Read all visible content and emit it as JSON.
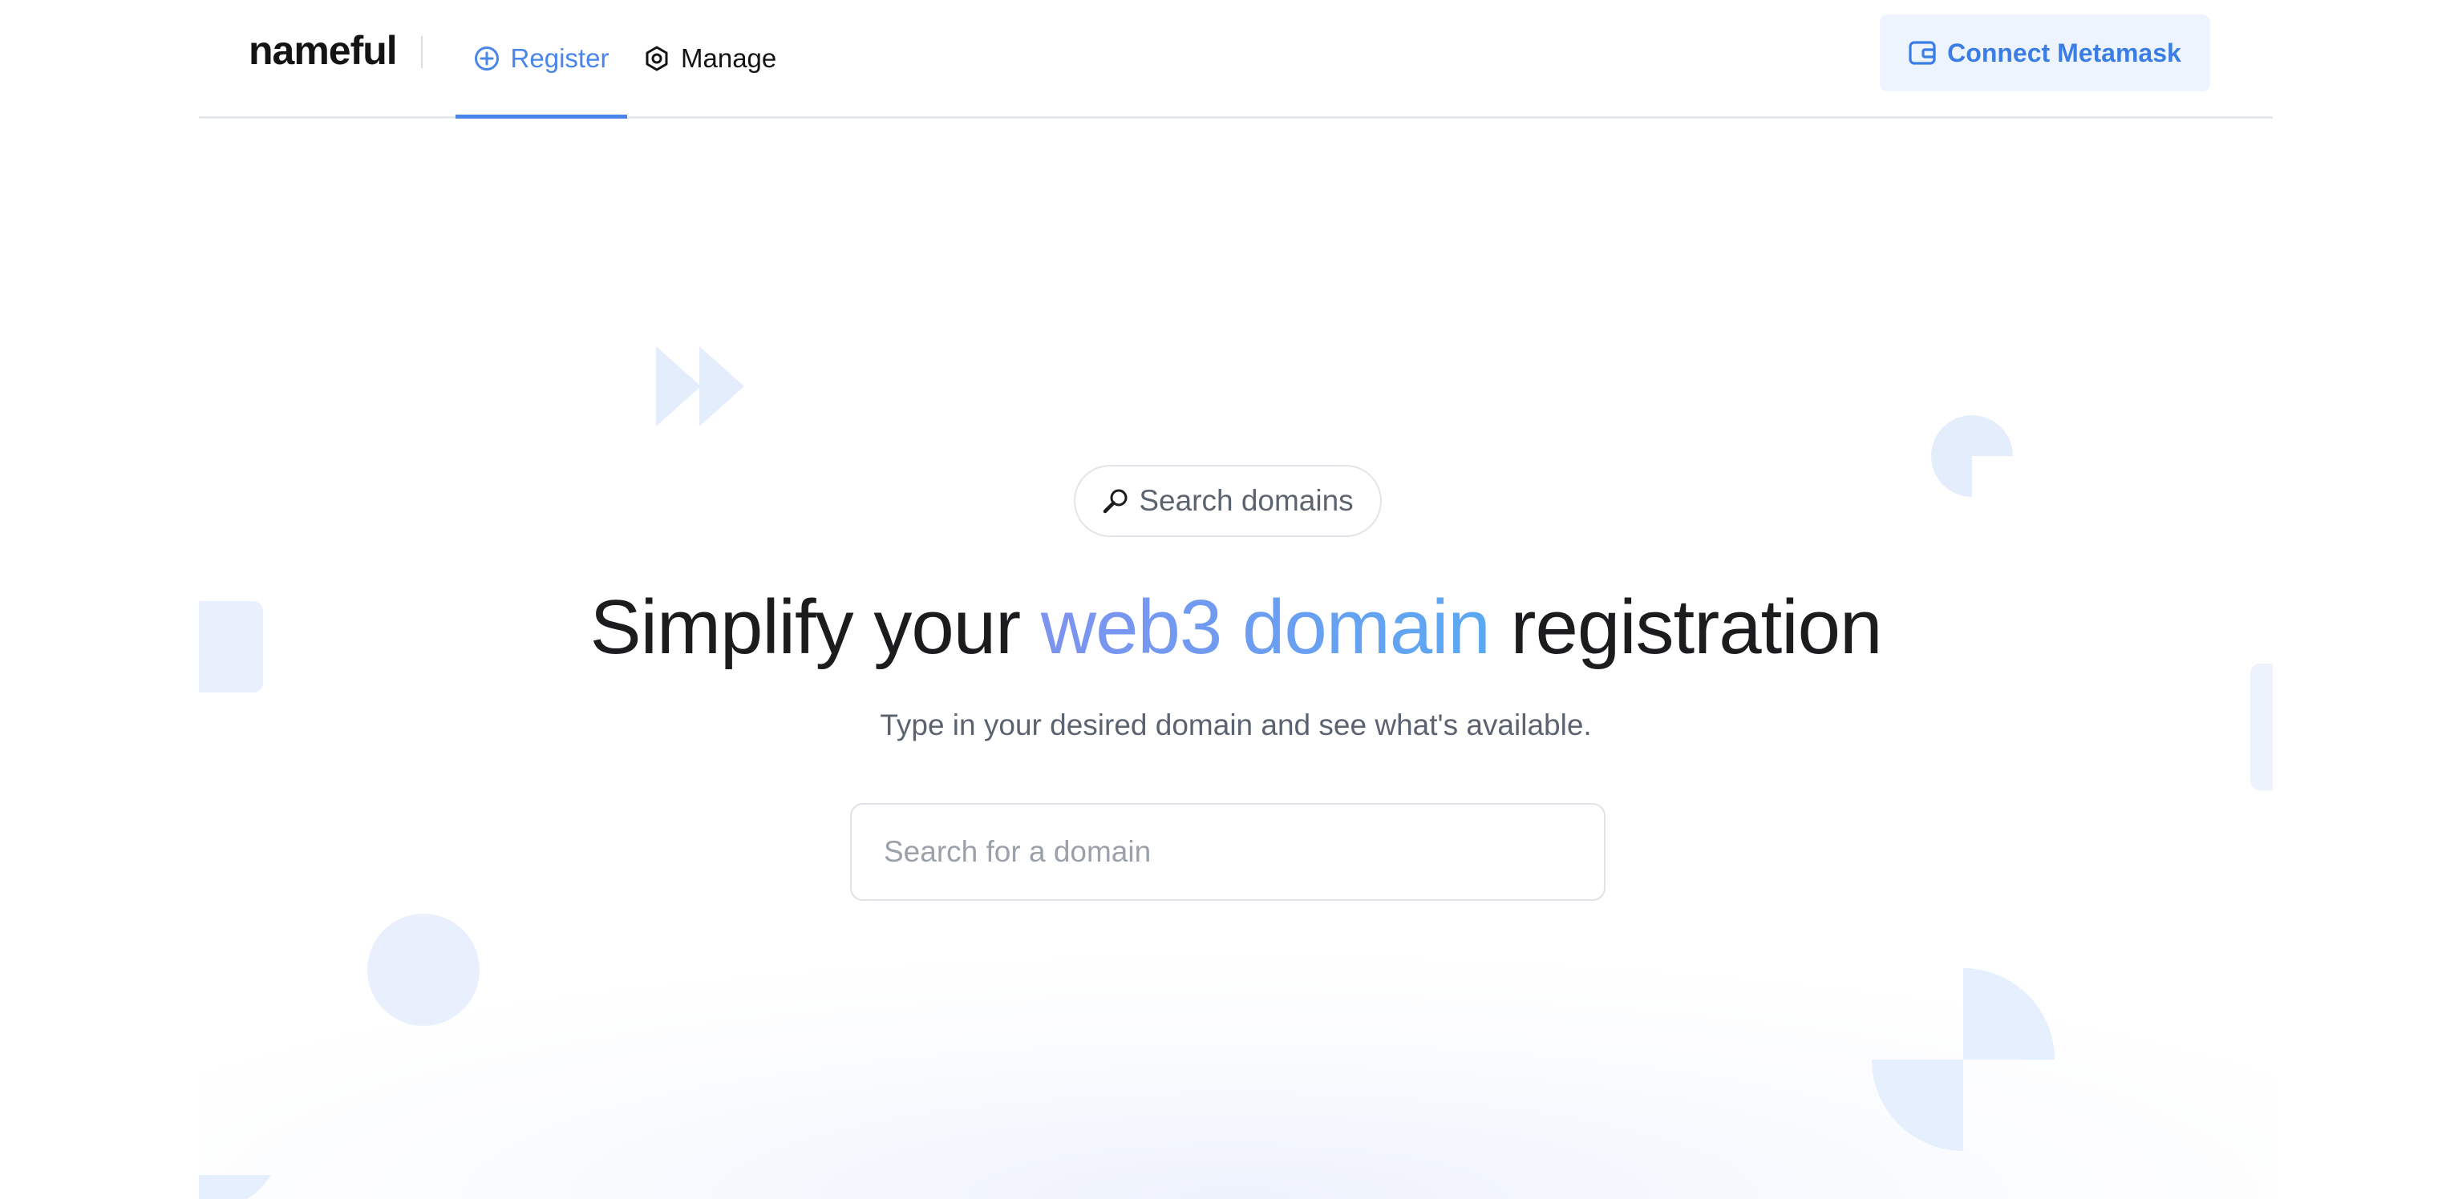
{
  "header": {
    "logo": "nameful",
    "nav": [
      {
        "label": "Register",
        "icon": "plus-circle-icon",
        "active": true
      },
      {
        "label": "Manage",
        "icon": "gear-icon",
        "active": false
      }
    ],
    "connect_label": "Connect Metamask",
    "connect_icon": "wallet-icon"
  },
  "hero": {
    "pill_label": "Search domains",
    "pill_icon": "magnifier-icon",
    "headline_before": "Simplify your ",
    "headline_accent": "web3 domain",
    "headline_after": " registration",
    "subtitle": "Type in your desired domain and see what's available.",
    "search_placeholder": "Search for a domain",
    "search_value": ""
  },
  "colors": {
    "accent": "#4a86ea",
    "accent_gradient_start": "#7e93ef",
    "accent_gradient_end": "#5aa9f2",
    "decoration": "#e6effd"
  }
}
